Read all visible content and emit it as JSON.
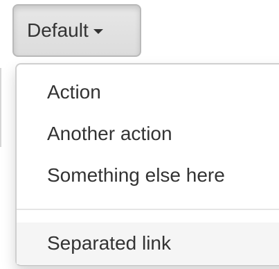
{
  "toggle": {
    "label": "Default"
  },
  "menu": {
    "items": [
      {
        "label": "Action"
      },
      {
        "label": "Another action"
      },
      {
        "label": "Something else here"
      }
    ],
    "separated_items": [
      {
        "label": "Separated link"
      }
    ]
  }
}
